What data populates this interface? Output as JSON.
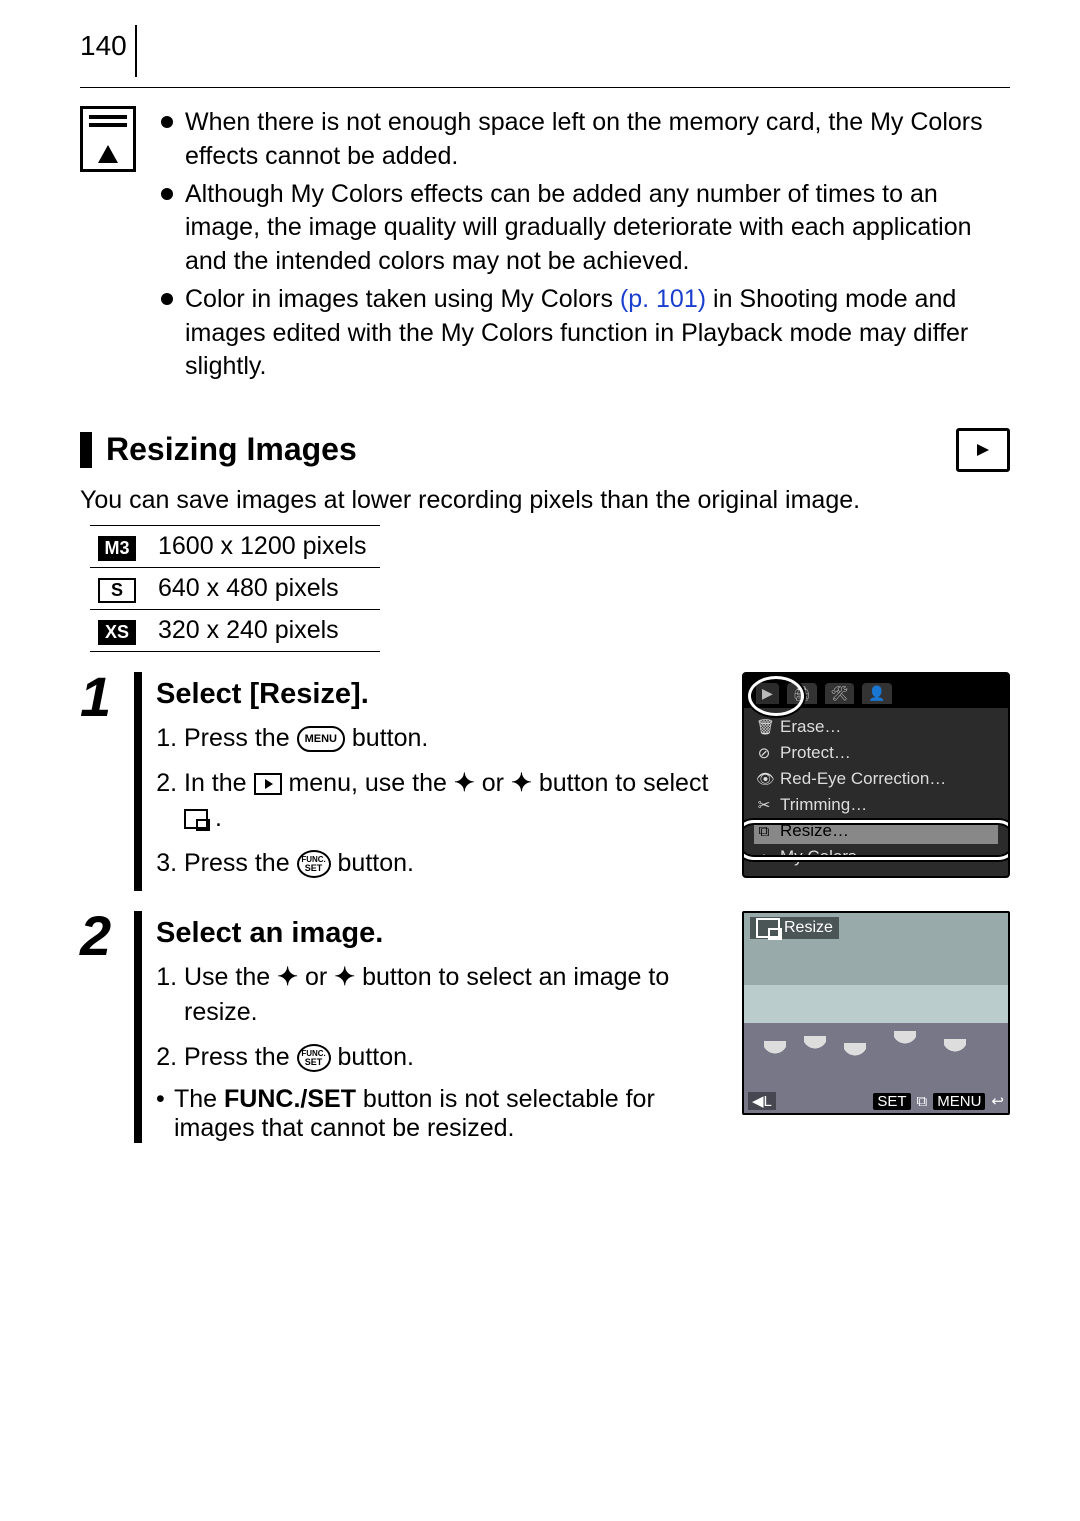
{
  "page_number": "140",
  "info_box": {
    "items": [
      "When there is not enough space left on the memory card, the My Colors effects cannot be added.",
      "Although My Colors effects can be added any number of times to an image, the image quality will gradually deteriorate with each application and the intended colors may not be achieved.",
      "Color in images taken using My Colors "
    ],
    "link_text": "(p. 101)",
    "item3_cont": " in Shooting mode and images edited with the My Colors function in Playback mode may differ slightly."
  },
  "section": {
    "title": "Resizing Images",
    "intro": "You can save images at lower recording pixels than the original image."
  },
  "sizes": [
    {
      "badge": "M3",
      "value": "1600 x 1200 pixels"
    },
    {
      "badge": "S",
      "value": "640 x 480 pixels"
    },
    {
      "badge": "XS",
      "value": "320 x 240 pixels"
    }
  ],
  "step1": {
    "title": "Select [Resize].",
    "i1a": "Press the ",
    "i1b": " button.",
    "i2a": "In the ",
    "i2b": " menu, use the ",
    "i2c": " or ",
    "i2d": " button to select ",
    "i2e": ".",
    "i3a": "Press the ",
    "i3b": " button."
  },
  "menu_screen": {
    "items": [
      {
        "icon": "🗑",
        "label": "Erase…"
      },
      {
        "icon": "⊘",
        "label": "Protect…"
      },
      {
        "icon": "👁",
        "label": "Red-Eye Correction…"
      },
      {
        "icon": "✂",
        "label": "Trimming…"
      },
      {
        "icon": "⧉",
        "label": "Resize…",
        "selected": true
      },
      {
        "icon": "◂▸",
        "label": "My Colors…"
      }
    ],
    "tabs": [
      "▶",
      "🖨",
      "🛠",
      "👤"
    ]
  },
  "step2": {
    "title": "Select an image.",
    "i1a": "Use the ",
    "i1b": " or ",
    "i1c": " button to select an image to resize.",
    "i2a": "Press the ",
    "i2b": " button.",
    "note_a": "The ",
    "note_b": "FUNC./SET",
    "note_c": " button is not selectable for images that cannot be resized."
  },
  "img_screen": {
    "title": "Resize",
    "bl": "◀L",
    "br1": "SET",
    "br2": "MENU",
    "br_icon": "⧉",
    "br_end": "↩"
  }
}
